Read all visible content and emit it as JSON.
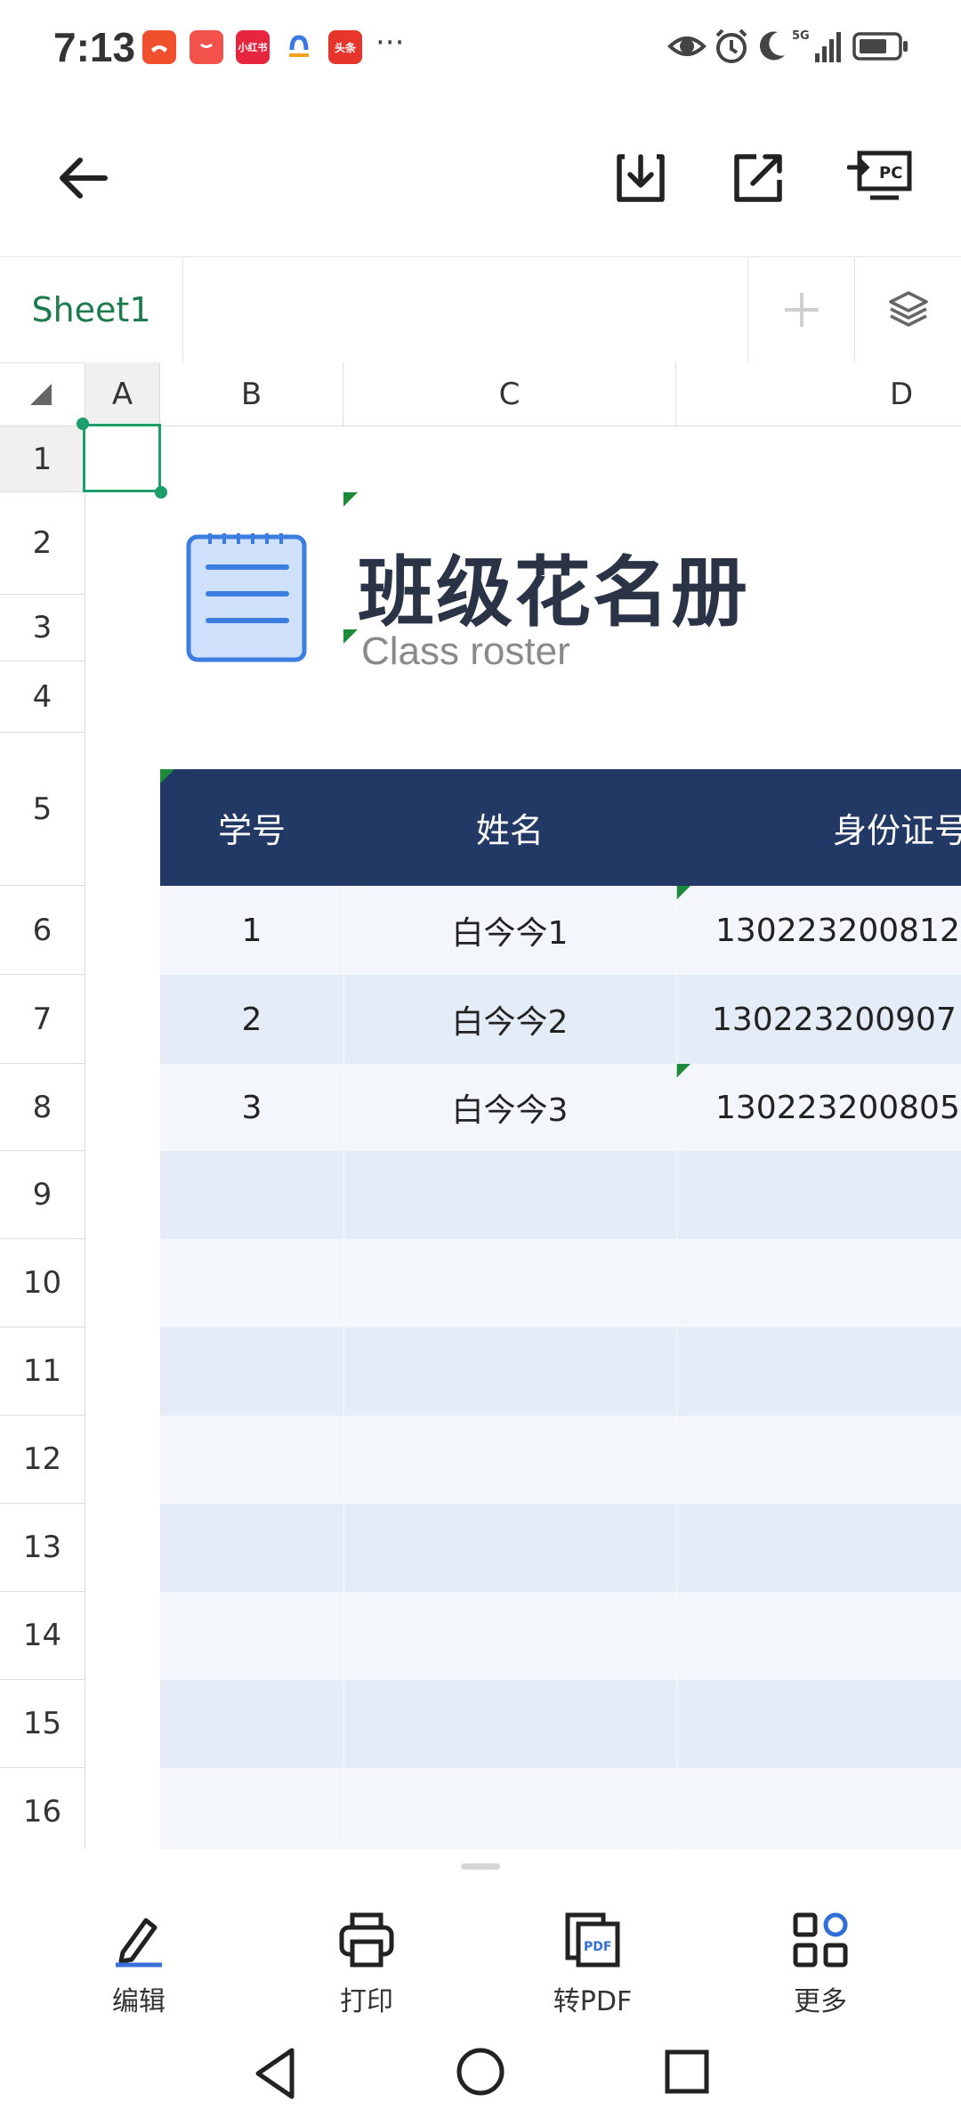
{
  "status_bar": {
    "time": "7:13",
    "notification_icons": [
      {
        "name": "missed-call-icon",
        "color": "#f0502e",
        "text": ""
      },
      {
        "name": "shopping-bag-icon",
        "color": "#f4534c",
        "text": ""
      },
      {
        "name": "xiaohongshu-icon",
        "color": "#e8253f",
        "text": "小红书"
      },
      {
        "name": "app-logo-icon",
        "color": "#3a78e8",
        "text": ""
      },
      {
        "name": "toutiao-icon",
        "color": "#e8352b",
        "text": "头条"
      }
    ],
    "more": "···",
    "network": "5G"
  },
  "toolbar": {
    "back": "back-arrow-icon",
    "download": "download-icon",
    "share": "share-icon",
    "pc_label": "PC"
  },
  "tabs": {
    "sheet_name": "Sheet1"
  },
  "grid": {
    "columns": [
      "A",
      "B",
      "C",
      "D"
    ],
    "rows": [
      "1",
      "2",
      "3",
      "4",
      "5",
      "6",
      "7",
      "8",
      "9",
      "10",
      "11",
      "12",
      "13",
      "14",
      "15",
      "16"
    ],
    "title_cn": "班级花名册",
    "title_en": "Class roster",
    "table_headers": [
      "学号",
      "姓名",
      "身份证号"
    ],
    "table_rows": [
      {
        "id": "1",
        "name": "白今今1",
        "id_card": "130223200812"
      },
      {
        "id": "2",
        "name": "白今今2",
        "id_card": "130223200907"
      },
      {
        "id": "3",
        "name": "白今今3",
        "id_card": "130223200805"
      }
    ],
    "header_color": "#233965",
    "row_colors": [
      "#f3f6fb",
      "#e4ecf7"
    ]
  },
  "bottom_actions": [
    {
      "label": "编辑",
      "icon": "pencil-icon"
    },
    {
      "label": "打印",
      "icon": "printer-icon"
    },
    {
      "label": "转PDF",
      "icon": "pdf-icon",
      "badge": "PDF"
    },
    {
      "label": "更多",
      "icon": "more-grid-icon"
    }
  ],
  "nav": [
    "back-triangle-icon",
    "home-circle-icon",
    "recents-square-icon"
  ]
}
